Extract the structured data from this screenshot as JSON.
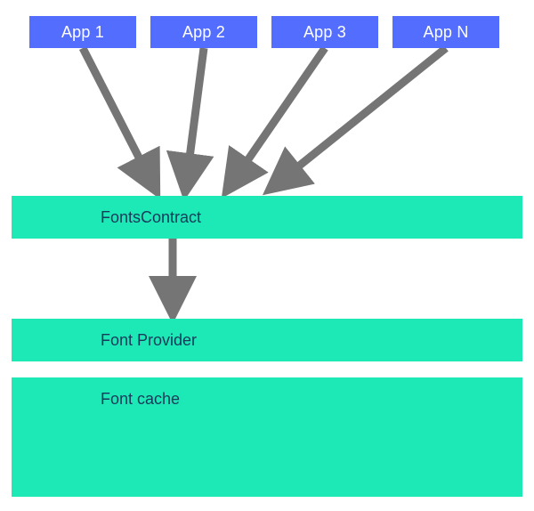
{
  "apps": {
    "app1": "App 1",
    "app2": "App 2",
    "app3": "App 3",
    "appN": "App N"
  },
  "layers": {
    "contract": "FontsContract",
    "provider": "Font Provider",
    "cache": "Font cache"
  },
  "colors": {
    "app": "#536dfe",
    "layer": "#1de9b6",
    "arrow": "#757575"
  }
}
